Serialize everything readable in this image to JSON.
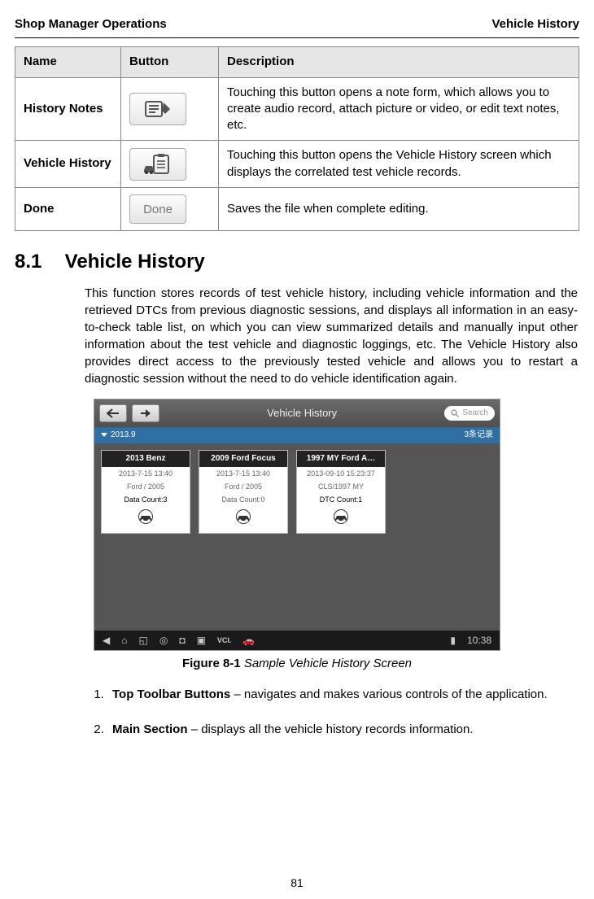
{
  "header": {
    "left": "Shop Manager Operations",
    "right": "Vehicle History"
  },
  "table": {
    "headers": {
      "name": "Name",
      "button": "Button",
      "description": "Description"
    },
    "rows": [
      {
        "name": "History Notes",
        "button_kind": "notes-icon",
        "button_text": "",
        "description": "Touching this button opens a note form, which allows you to create audio record, attach picture or video, or edit text notes, etc."
      },
      {
        "name": "Vehicle History",
        "button_kind": "history-icon",
        "button_text": "",
        "description": "Touching this button opens the Vehicle History screen which displays the correlated test vehicle records."
      },
      {
        "name": "Done",
        "button_kind": "done-label",
        "button_text": "Done",
        "description": "Saves the file when complete editing."
      }
    ]
  },
  "section": {
    "number": "8.1",
    "title": "Vehicle History"
  },
  "body_paragraph": "This function stores records of test vehicle history, including vehicle information and the retrieved DTCs from previous diagnostic sessions, and displays all information in an easy-to-check table list, on which you can view summarized details and manually input other information about the test vehicle and diagnostic loggings, etc. The Vehicle History also provides direct access to the previously tested vehicle and allows you to restart a diagnostic session without the need to do vehicle identification again.",
  "figure": {
    "toolbar_title": "Vehicle History",
    "search_placeholder": "Search",
    "band_left": "2013.9",
    "band_right": "3条记录",
    "cards": [
      {
        "title": "2013 Benz",
        "time": "2013-7-15 13:40",
        "sub": "Ford / 2005",
        "count": "Data Count:3"
      },
      {
        "title": "2009 Ford Focus",
        "time": "2013-7-15 13:40",
        "sub": "Ford / 2005",
        "count": "Data Count:0"
      },
      {
        "title": "1997 MY Ford A…",
        "time": "2013-09-10 15:23:37",
        "sub": "CLS/1997 MY",
        "count": "DTC Count:1"
      }
    ],
    "clock": "10:38",
    "caption_label": "Figure 8-1",
    "caption_title": " Sample Vehicle History Screen"
  },
  "list": [
    {
      "lead": "Top Toolbar Buttons",
      "rest": " – navigates and makes various controls of the application."
    },
    {
      "lead": "Main Section",
      "rest": " – displays all the vehicle history records information."
    }
  ],
  "page_number": "81"
}
